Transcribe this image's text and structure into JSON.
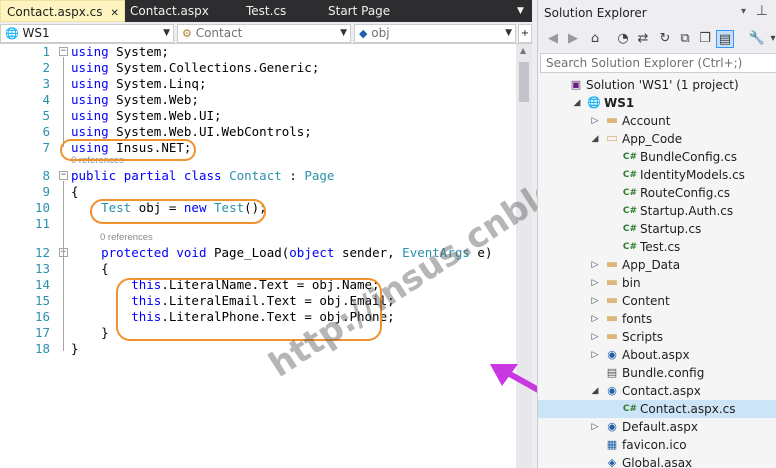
{
  "tabs": [
    {
      "label": "Contact.aspx.cs",
      "active": true
    },
    {
      "label": "Contact.aspx"
    },
    {
      "label": "Test.cs"
    },
    {
      "label": "Start Page"
    }
  ],
  "nav": {
    "project": "WS1",
    "class": "Contact",
    "member": "obj"
  },
  "code_lines": [
    {
      "n": "1",
      "html": "<span class='kw'>using</span> System;"
    },
    {
      "n": "2",
      "html": "<span class='kw'>using</span> System.Collections.Generic;"
    },
    {
      "n": "3",
      "html": "<span class='kw'>using</span> System.Linq;"
    },
    {
      "n": "4",
      "html": "<span class='kw'>using</span> System.Web;"
    },
    {
      "n": "5",
      "html": "<span class='kw'>using</span> System.Web.UI;"
    },
    {
      "n": "6",
      "html": "<span class='kw'>using</span> System.Web.UI.WebControls;"
    },
    {
      "n": "7",
      "html": "<span class='kw'>using</span> Insus.NET;"
    },
    {
      "n": "8",
      "html": "<span class='kw'>public</span> <span class='kw'>partial</span> <span class='kw'>class</span> <span class='ty'>Contact</span> : <span class='ty'>Page</span>"
    },
    {
      "n": "9",
      "html": "{"
    },
    {
      "n": "10",
      "html": "    <span class='ty'>Test</span> obj = <span class='kw'>new</span> <span class='ty'>Test</span>();"
    },
    {
      "n": "11",
      "html": ""
    },
    {
      "n": "12",
      "html": "    <span class='kw'>protected</span> <span class='kw'>void</span> Page_Load(<span class='kw'>object</span> sender, <span class='ty'>EventArgs</span> e)"
    },
    {
      "n": "13",
      "html": "    {"
    },
    {
      "n": "14",
      "html": "        <span class='kw'>this</span>.LiteralName.Text = obj.Name;"
    },
    {
      "n": "15",
      "html": "        <span class='kw'>this</span>.LiteralEmail.Text = obj.Email;"
    },
    {
      "n": "16",
      "html": "        <span class='kw'>this</span>.LiteralPhone.Text = obj.Phone;"
    },
    {
      "n": "17",
      "html": "    }"
    },
    {
      "n": "18",
      "html": "}"
    }
  ],
  "references": [
    "0 references",
    "0 references"
  ],
  "watermark": "http://insus.cnblogs.com",
  "solution_explorer": {
    "title": "Solution Explorer",
    "search_placeholder": "Search Solution Explorer (Ctrl+;)",
    "items": [
      {
        "label": "Solution 'WS1' (1 project)",
        "icon": "solution-icon",
        "arrow": ""
      },
      {
        "label": "WS1",
        "icon": "globe-icon",
        "arrow": "expanded",
        "bold": true
      },
      {
        "label": "Account",
        "icon": "folder-icon",
        "arrow": "collapsed"
      },
      {
        "label": "App_Code",
        "icon": "folder-open-icon",
        "arrow": "expanded"
      },
      {
        "label": "BundleConfig.cs",
        "icon": "csharp-file-icon",
        "arrow": ""
      },
      {
        "label": "IdentityModels.cs",
        "icon": "csharp-file-icon",
        "arrow": ""
      },
      {
        "label": "RouteConfig.cs",
        "icon": "csharp-file-icon",
        "arrow": ""
      },
      {
        "label": "Startup.Auth.cs",
        "icon": "csharp-file-icon",
        "arrow": ""
      },
      {
        "label": "Startup.cs",
        "icon": "csharp-file-icon",
        "arrow": ""
      },
      {
        "label": "Test.cs",
        "icon": "csharp-file-icon",
        "arrow": ""
      },
      {
        "label": "App_Data",
        "icon": "folder-icon",
        "arrow": "collapsed"
      },
      {
        "label": "bin",
        "icon": "folder-icon",
        "arrow": "collapsed"
      },
      {
        "label": "Content",
        "icon": "folder-icon",
        "arrow": "collapsed"
      },
      {
        "label": "fonts",
        "icon": "folder-icon",
        "arrow": "collapsed"
      },
      {
        "label": "Scripts",
        "icon": "folder-icon",
        "arrow": "collapsed"
      },
      {
        "label": "About.aspx",
        "icon": "aspx-file-icon",
        "arrow": "collapsed"
      },
      {
        "label": "Bundle.config",
        "icon": "config-file-icon",
        "arrow": ""
      },
      {
        "label": "Contact.aspx",
        "icon": "aspx-file-icon",
        "arrow": "expanded"
      },
      {
        "label": "Contact.aspx.cs",
        "icon": "csharp-file-icon",
        "arrow": "",
        "selected": true
      },
      {
        "label": "Default.aspx",
        "icon": "aspx-file-icon",
        "arrow": "collapsed"
      },
      {
        "label": "favicon.ico",
        "icon": "ico-file-icon",
        "arrow": ""
      },
      {
        "label": "Global.asax",
        "icon": "asax-file-icon",
        "arrow": ""
      }
    ]
  },
  "colors": {
    "keyword": "#0000ff",
    "type": "#2b91af",
    "line_number": "#2b91af",
    "highlight_oval": "#f0922e",
    "annotation_arrow": "#c837e0",
    "selected_row": "#cce4f7"
  }
}
